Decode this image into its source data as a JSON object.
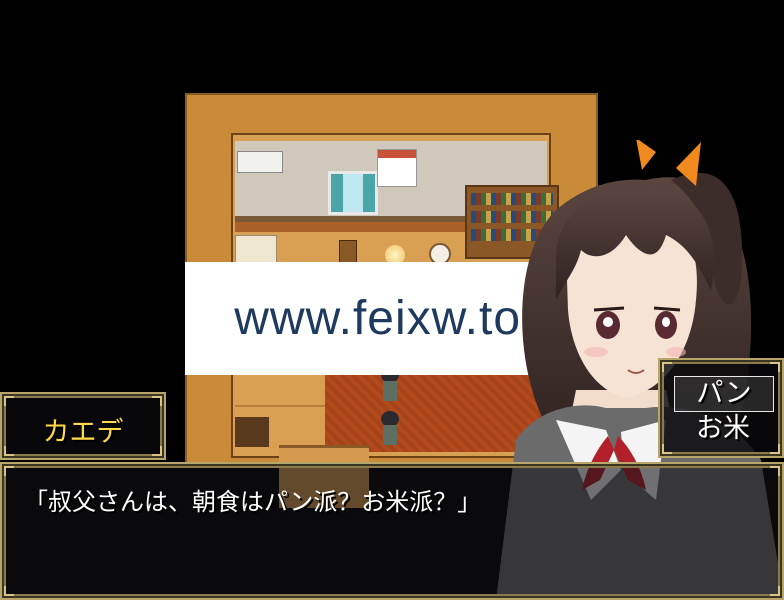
{
  "watermark": {
    "text": "www.feixw.top"
  },
  "name_window": {
    "speaker": "カエデ"
  },
  "choice_window": {
    "options": [
      "パン",
      "お米"
    ],
    "selected_index": 0
  },
  "message_window": {
    "text": "「叔父さんは、朝食はパン派？お米派？」"
  },
  "colors": {
    "name_text": "#ffd94a",
    "window_border": "#b8a56a",
    "message_text": "#ffffff"
  }
}
